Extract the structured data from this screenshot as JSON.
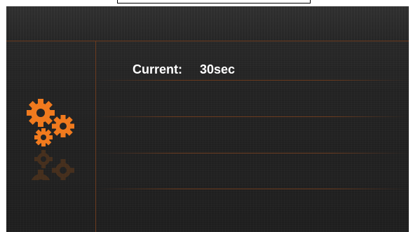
{
  "status": {
    "current_label": "Current:",
    "current_value": "30sec"
  },
  "icons": {
    "settings": "gears-icon"
  },
  "colors": {
    "accent": "#f07a1e",
    "divider": "#6a3a1e",
    "background": "#222222",
    "text": "#ffffff"
  }
}
